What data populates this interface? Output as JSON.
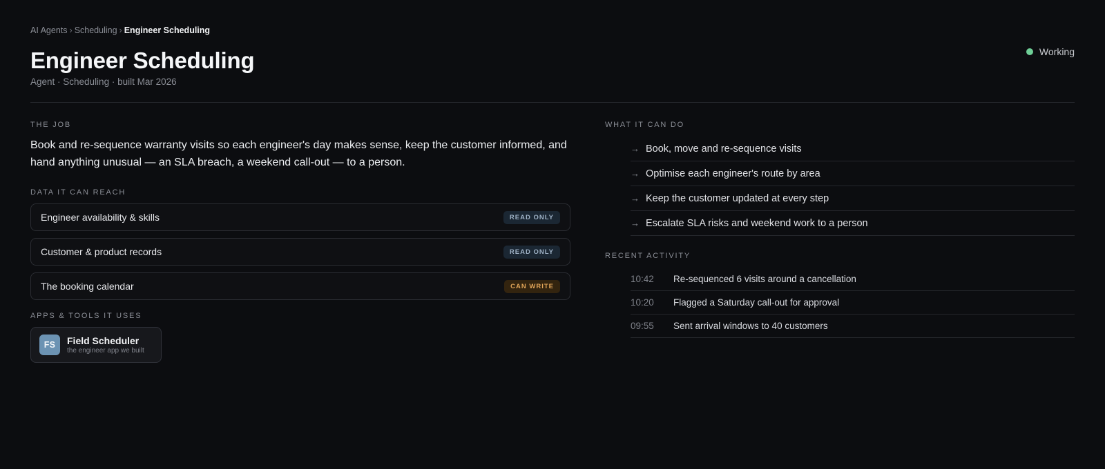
{
  "breadcrumb": {
    "items": [
      "AI Agents",
      "Scheduling"
    ],
    "separator": "›",
    "current": "Engineer Scheduling"
  },
  "header": {
    "title": "Engineer Scheduling",
    "subtitle": "Agent · Scheduling · built Mar 2026"
  },
  "status": {
    "label": "Working",
    "color": "#6fcf97"
  },
  "job": {
    "label": "THE JOB",
    "text": "Book and re-sequence warranty visits so each engineer's day makes sense, keep the customer informed, and hand anything unusual — an SLA breach, a weekend call-out — to a person."
  },
  "data_access": {
    "label": "DATA IT CAN REACH",
    "items": [
      {
        "name": "Engineer availability & skills",
        "permission": "READ ONLY"
      },
      {
        "name": "Customer & product records",
        "permission": "READ ONLY"
      },
      {
        "name": "The booking calendar",
        "permission": "CAN WRITE"
      }
    ]
  },
  "apps": {
    "label": "APPS & TOOLS IT USES",
    "items": [
      {
        "initials": "FS",
        "name": "Field Scheduler",
        "description": "the engineer app we built"
      }
    ]
  },
  "capabilities": {
    "label": "WHAT IT CAN DO",
    "icon": "arrow-right-icon",
    "items": [
      "Book, move and re-sequence visits",
      "Optimise each engineer's route by area",
      "Keep the customer updated at every step",
      "Escalate SLA risks and weekend work to a person"
    ]
  },
  "activity": {
    "label": "RECENT ACTIVITY",
    "items": [
      {
        "time": "10:42",
        "event": "Re-sequenced 6 visits around a cancellation"
      },
      {
        "time": "10:20",
        "event": "Flagged a Saturday call-out for approval"
      },
      {
        "time": "09:55",
        "event": "Sent arrival windows to 40 customers"
      }
    ]
  }
}
